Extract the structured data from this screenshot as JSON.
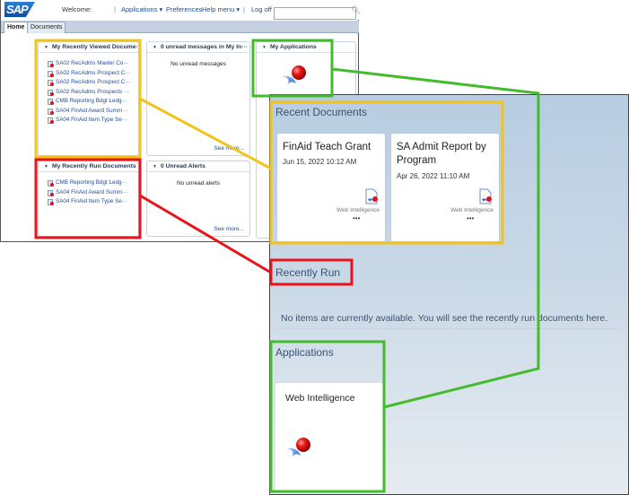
{
  "old_ui": {
    "logo": "SAP",
    "nav": {
      "welcome": "Welcome:",
      "applications": "Applications ▾",
      "preferences": "Preferences",
      "help_menu": "Help menu ▾",
      "log_off": "Log off",
      "separator": "|"
    },
    "search": {
      "value": "",
      "placeholder": ""
    },
    "tabs": [
      {
        "label": "Home",
        "active": true
      },
      {
        "label": "Documents",
        "active": false
      }
    ],
    "portlets": {
      "recently_viewed": {
        "title": "My Recently Viewed Docume···",
        "items": [
          "SA02 RecAdms Master Co···",
          "SA02 RecAdms Prospect C···",
          "SA02 RecAdms Prospect C···",
          "SA02 RecAdms Prospects ···",
          "CMB Reporting Bdgt Ledg···",
          "SA04 FinAid Award Summ···",
          "SA04 FinAid Item Type Se···"
        ]
      },
      "inbox": {
        "title": "0 unread messages in My In···",
        "message": "No unread messages",
        "see_more": "See more..."
      },
      "applications": {
        "title": "My Applications",
        "icon": "web-intelligence-icon"
      },
      "recently_run": {
        "title": "My Recently Run Documents",
        "items": [
          "CMB Reporting Bdgt Ledg···",
          "SA04 FinAid Award Summ···",
          "SA04 FinAid Item Type Se···"
        ]
      },
      "alerts": {
        "title": "0 Unread Alerts",
        "message": "No unread alerts",
        "see_more": "See more..."
      }
    }
  },
  "new_ui": {
    "recent_documents": {
      "title": "Recent Documents",
      "cards": [
        {
          "title": "FinAid Teach Grant",
          "date": "Jun 15, 2022 10:12 AM",
          "type": "Web Intelligence",
          "more": "•••"
        },
        {
          "title": "SA Admit Report by Program",
          "date": "Apr 26, 2022 11:10 AM",
          "type": "Web Intelligence",
          "more": "•••"
        }
      ]
    },
    "recently_run": {
      "title": "Recently Run",
      "empty_message": "No items are currently available. You will see the recently run documents here."
    },
    "applications": {
      "title": "Applications",
      "tiles": [
        {
          "title": "Web Intelligence",
          "icon": "web-intelligence-icon"
        }
      ]
    }
  },
  "annotations": {
    "colors": {
      "yellow": "#f2c31b",
      "red": "#e8141c",
      "green": "#44bb2a"
    }
  }
}
